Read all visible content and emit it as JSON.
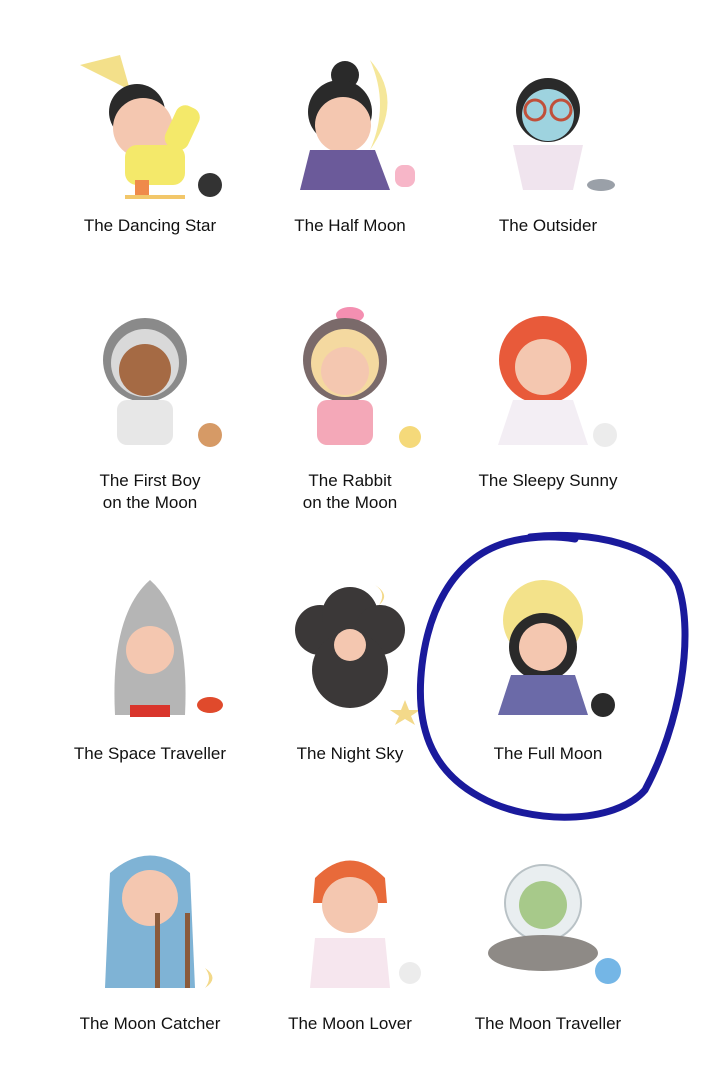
{
  "items": [
    {
      "name": "The Dancing Star"
    },
    {
      "name": "The Half Moon"
    },
    {
      "name": "The Outsider"
    },
    {
      "name": "The First Boy\non the Moon"
    },
    {
      "name": "The Rabbit\non the Moon"
    },
    {
      "name": "The Sleepy Sunny"
    },
    {
      "name": "The Space Traveller"
    },
    {
      "name": "The Night Sky"
    },
    {
      "name": "The Full Moon"
    },
    {
      "name": "The Moon Catcher"
    },
    {
      "name": "The Moon Lover"
    },
    {
      "name": "The Moon Traveller"
    }
  ],
  "highlight": {
    "circled_item": "The Full Moon",
    "color": "#1a1a9c"
  },
  "colors": {
    "background": "#ffffff",
    "text": "#111111"
  }
}
